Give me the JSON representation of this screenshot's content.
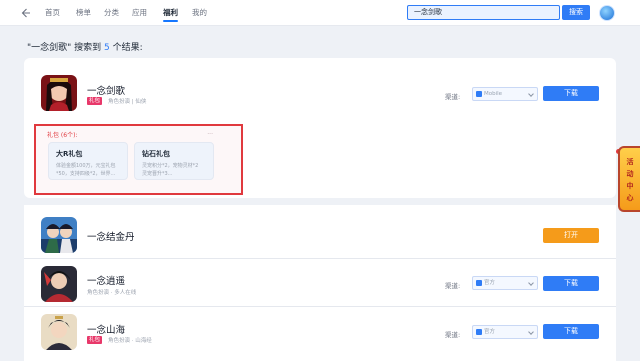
{
  "nav": {
    "items": [
      "首页",
      "榜单",
      "分类",
      "应用",
      "福利",
      "我的"
    ],
    "active_label": "福利"
  },
  "search": {
    "value": "一念剑歌",
    "button": "搜索"
  },
  "results": {
    "prefix": "\"一念剑歌\" 搜索到",
    "count": "5",
    "suffix": "个结果:"
  },
  "games": [
    {
      "title": "一念剑歌",
      "tag": "礼包",
      "subtitle": "角色扮演 | 仙侠",
      "channel_label": "渠道:",
      "channel_value": "Mobile",
      "action": "下载"
    },
    {
      "title": "一念结金丹",
      "tag": "",
      "subtitle": "",
      "channel_label": "",
      "channel_value": "",
      "action": "打开"
    },
    {
      "title": "一念逍遥",
      "tag": "",
      "subtitle": "角色扮演 · 多人在线",
      "channel_label": "渠道:",
      "channel_value": "官方",
      "action": "下载"
    },
    {
      "title": "一念山海",
      "tag": "礼包",
      "subtitle": "角色扮演 · 山海经",
      "channel_label": "渠道:",
      "channel_value": "官方",
      "action": "下载"
    }
  ],
  "gifts": {
    "title": "礼包 (6个):",
    "more": "...",
    "items": [
      {
        "name": "大R礼包",
        "line1": "体验金额100万，元宝礼包",
        "line2": "*50，支持四级*2，世界..."
      },
      {
        "name": "钻石礼包",
        "line1": "灵宠积分*2，宠物灵材*2",
        "line2": "灵宠晋升*3..."
      }
    ]
  },
  "side_tab": {
    "label": "活动中心"
  },
  "colors": {
    "accent": "#2f7cf6",
    "open_button": "#f59b1a",
    "highlight": "#e0393e",
    "tag": "#e8386a"
  }
}
